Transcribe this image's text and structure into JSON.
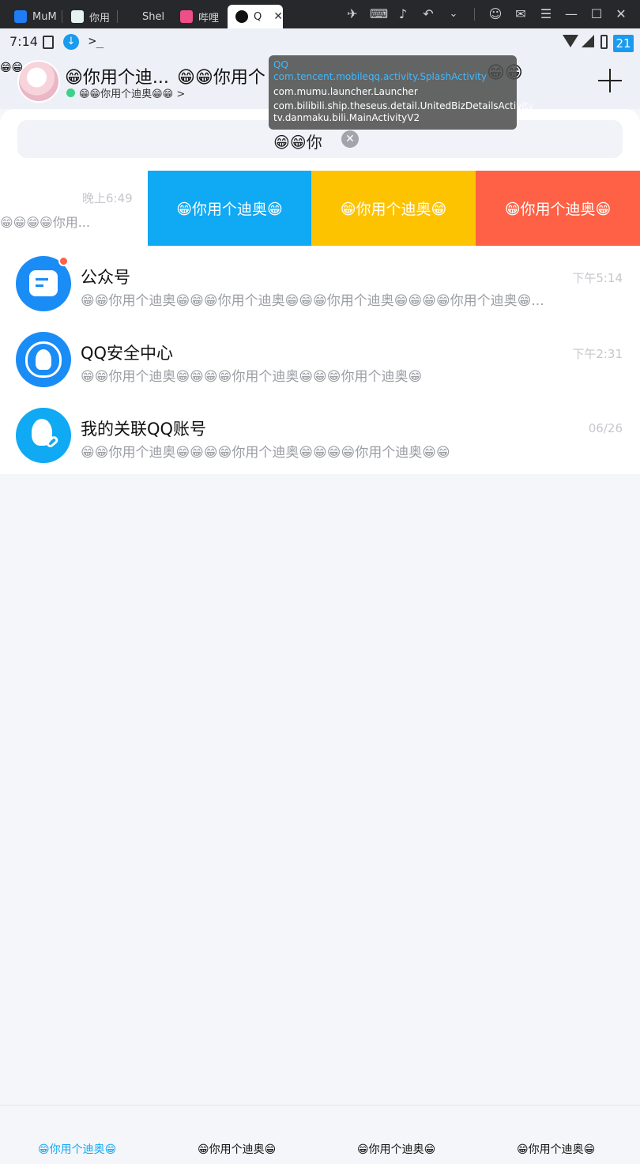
{
  "window": {
    "tabs": [
      {
        "label": "MuM",
        "active": false
      },
      {
        "label": "你用",
        "active": false
      },
      {
        "label": "Shel",
        "active": false
      },
      {
        "label": "哔哩",
        "active": false
      },
      {
        "label": "Q",
        "active": true
      }
    ],
    "controls": [
      "pin-icon",
      "keyboard-icon",
      "volume-icon",
      "back-icon",
      "dropdown-icon",
      "account-icon",
      "mail-icon",
      "menu-icon",
      "minimize-icon",
      "maximize-icon",
      "close-icon"
    ]
  },
  "statusbar": {
    "time": "7:14",
    "battery_level": "21",
    "accent": "#1a9bf0"
  },
  "header": {
    "left_emojis": "😁😁",
    "title": "😁你用个迪...",
    "title_overflow": "😁😁你用个",
    "title_tail": "😁😁",
    "status": "😁😁你用个迪奥😁😁",
    "status_arrow": ">"
  },
  "tooltip": {
    "lines": [
      {
        "text": "QQ",
        "highlight": true
      },
      {
        "text": "com.tencent.mobileqq.activity.SplashActivity",
        "highlight": true
      },
      {
        "text": "com.mumu.launcher.Launcher",
        "highlight": false
      },
      {
        "text": "com.bilibili.ship.theseus.detail.UnitedBizDetailsActivity",
        "highlight": false
      },
      {
        "text": "tv.danmaku.bili.MainActivityV2",
        "highlight": false
      }
    ]
  },
  "search": {
    "value": "😁😁你",
    "clear": "✕"
  },
  "swiped_row": {
    "time": "晚上6:49",
    "preview": "😁😁😁😁你用...",
    "actions": [
      {
        "label": "😁你用个迪奥😁",
        "color": "#10a9f3"
      },
      {
        "label": "😁你用个迪奥😁",
        "color": "#fdc300"
      },
      {
        "label": "😁你用个迪奥😁",
        "color": "#fe6145"
      }
    ]
  },
  "conversations": [
    {
      "name": "公众号",
      "time": "下午5:14",
      "preview": "😁😁你用个迪奥😁😁😁你用个迪奥😁😁😁你用个迪奥😁😁😁😁你用个迪奥😁...",
      "unread_dot": true
    },
    {
      "name": "QQ安全中心",
      "time": "下午2:31",
      "preview": "😁😁你用个迪奥😁😁😁😁你用个迪奥😁😁😁你用个迪奥😁",
      "unread_dot": false
    },
    {
      "name": "我的关联QQ账号",
      "time": "06/26",
      "preview": "😁😁你用个迪奥😁😁😁😁你用个迪奥😁😁😁😁你用个迪奥😁😁",
      "unread_dot": false
    }
  ],
  "tabbar": [
    {
      "label": "😁你用个迪奥😁",
      "active": true
    },
    {
      "label": "😁你用个迪奥😁",
      "active": false
    },
    {
      "label": "😁你用个迪奥😁",
      "active": false
    },
    {
      "label": "😁你用个迪奥😁",
      "active": false
    }
  ]
}
